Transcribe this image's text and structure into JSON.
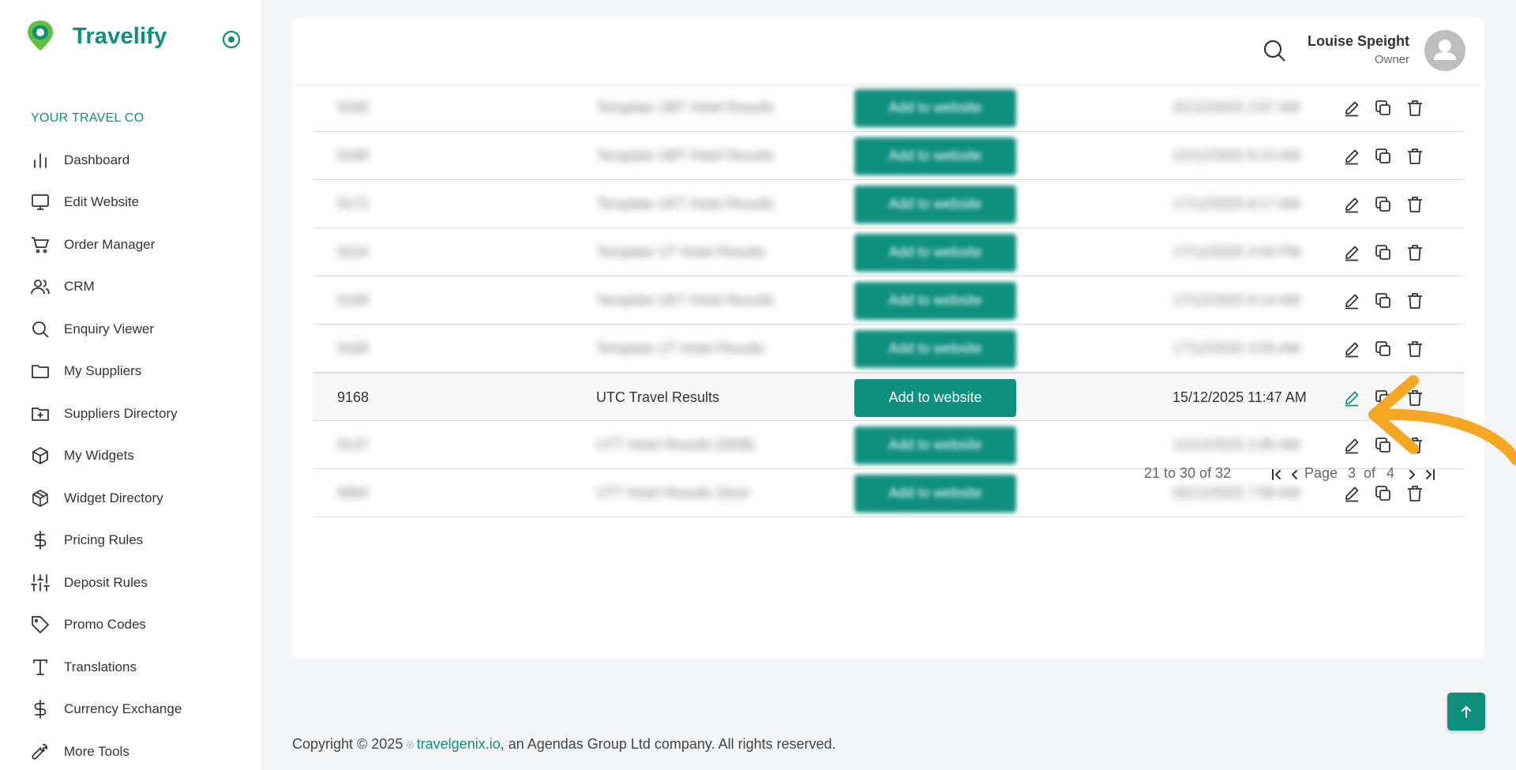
{
  "app": {
    "name": "Travelify",
    "org": "YOUR TRAVEL CO",
    "accent": "#0f8f7e",
    "arrow_color": "#f5a623"
  },
  "sidebar": {
    "items": [
      {
        "label": "Dashboard",
        "icon": "bar-chart-icon"
      },
      {
        "label": "Edit Website",
        "icon": "monitor-icon"
      },
      {
        "label": "Order Manager",
        "icon": "cart-icon"
      },
      {
        "label": "CRM",
        "icon": "users-icon"
      },
      {
        "label": "Enquiry Viewer",
        "icon": "search-icon"
      },
      {
        "label": "My Suppliers",
        "icon": "folder-icon"
      },
      {
        "label": "Suppliers Directory",
        "icon": "folder-plus-icon"
      },
      {
        "label": "My Widgets",
        "icon": "cube-icon"
      },
      {
        "label": "Widget Directory",
        "icon": "boxes-icon"
      },
      {
        "label": "Pricing Rules",
        "icon": "dollar-icon"
      },
      {
        "label": "Deposit Rules",
        "icon": "sliders-icon"
      },
      {
        "label": "Promo Codes",
        "icon": "tag-icon"
      },
      {
        "label": "Translations",
        "icon": "type-icon"
      },
      {
        "label": "Currency Exchange",
        "icon": "dollar-icon"
      },
      {
        "label": "More Tools",
        "icon": "wrench-icon"
      }
    ]
  },
  "header": {
    "user_name": "Louise Speight",
    "user_role": "Owner"
  },
  "table": {
    "button_label": "Add to website",
    "rows": [
      {
        "id": "9180",
        "name": "Template UBT Hotel Results",
        "date": "22/12/2025 2:07 AM",
        "blurred": true
      },
      {
        "id": "9180",
        "name": "Template UBT Hotel Results",
        "date": "22/12/2025 9:14 AM",
        "blurred": true
      },
      {
        "id": "9172",
        "name": "Template UKT Hotel Results",
        "date": "17/12/2025 8:17 AM",
        "blurred": true
      },
      {
        "id": "9154",
        "name": "Template UT Hotel Results",
        "date": "17/12/2025 3:44 PM",
        "blurred": true
      },
      {
        "id": "9169",
        "name": "Template UKT Hotel Results",
        "date": "17/12/2025 9:14 AM",
        "blurred": true
      },
      {
        "id": "9168",
        "name": "Template UT Hotel Results",
        "date": "17/12/2025 3:55 AM",
        "blurred": true
      },
      {
        "id": "9168",
        "name": "UTC Travel Results",
        "date": "15/12/2025 11:47 AM",
        "blurred": false
      },
      {
        "id": "9137",
        "name": "UTT Hotel Results (DEB)",
        "date": "12/12/2025 2:05 AM",
        "blurred": true
      },
      {
        "id": "9064",
        "name": "UTT Hotel Results Short",
        "date": "05/12/2025 7:58 AM",
        "blurred": true
      }
    ]
  },
  "pager": {
    "summary": "21 to 30 of 32",
    "page_label": "Page",
    "page": "3",
    "of_label": "of",
    "total_pages": "4"
  },
  "footer": {
    "prefix": "Copyright © 2025 ",
    "link": "travelgenix.io",
    "suffix": ", an Agendas Group Ltd company. All rights reserved."
  }
}
